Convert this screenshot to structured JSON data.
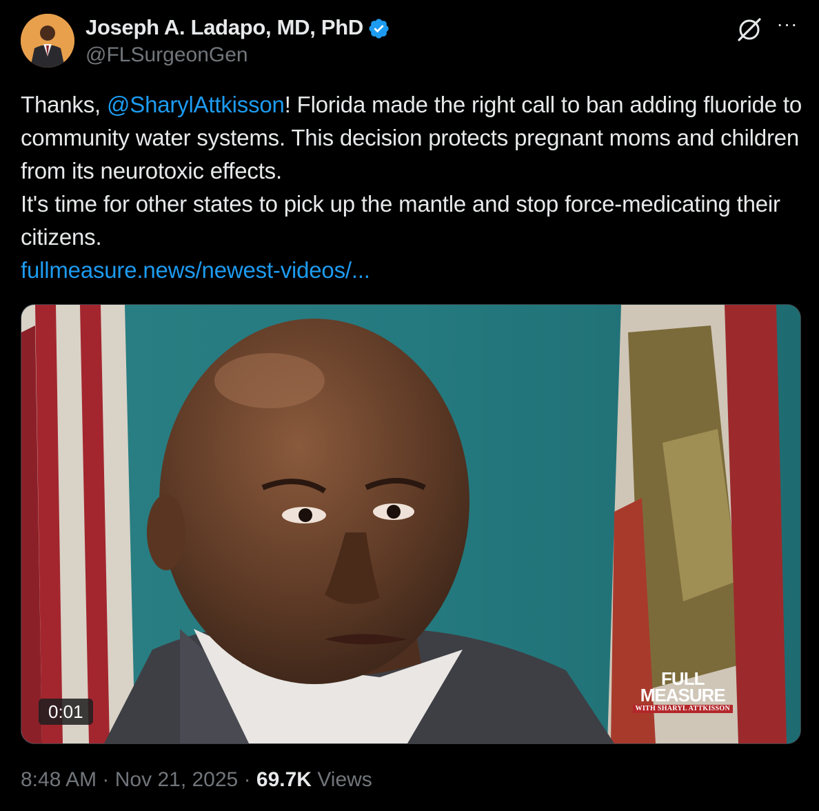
{
  "author": {
    "name": "Joseph A. Ladapo, MD, PhD",
    "handle": "@FLSurgeonGen",
    "verified": true,
    "avatar_icon": "profile-photo"
  },
  "header_actions": {
    "grok_icon": "grok-icon",
    "more_label": "···"
  },
  "tweet": {
    "prefix": "Thanks, ",
    "mention": "@SharylAttkisson",
    "line1_rest": "! Florida made the right call to ban adding fluoride to community water systems. This decision protects pregnant moms and children from its neurotoxic effects.",
    "line2": "It's time for other states to pick up the mantle and stop force-medicating their citizens.",
    "link": "fullmeasure.news/newest-videos/..."
  },
  "media": {
    "type": "video",
    "duration": "0:01",
    "watermark": {
      "line1": "FULL",
      "line2": "MEASURE",
      "line3": "WITH SHARYL ATTKISSON"
    }
  },
  "meta": {
    "time": "8:48 AM",
    "date": "Nov 21, 2025",
    "separator": "·",
    "views_count": "69.7K",
    "views_label": "Views"
  },
  "colors": {
    "background": "#000000",
    "text": "#e7e9ea",
    "secondary": "#71767b",
    "link": "#1d9bf0"
  }
}
